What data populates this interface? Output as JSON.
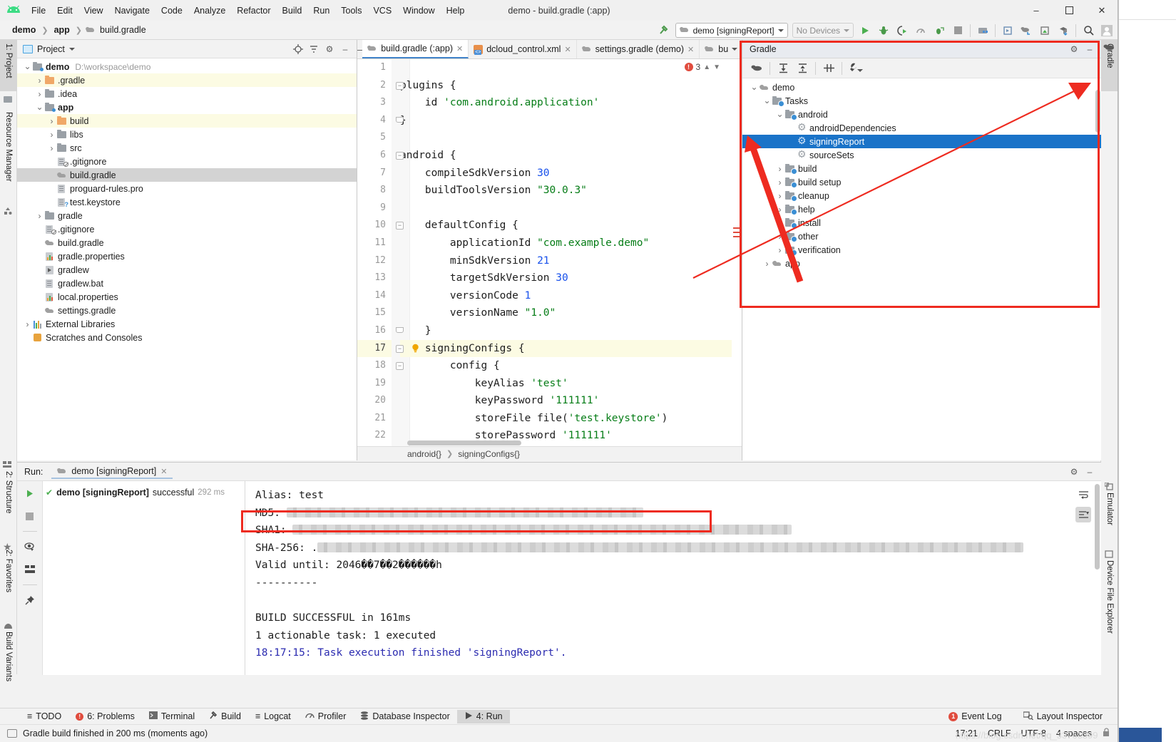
{
  "window": {
    "title": "demo - build.gradle (:app)",
    "minimize": "–",
    "maximize": "☐",
    "close": "✕"
  },
  "menu": [
    "File",
    "Edit",
    "View",
    "Navigate",
    "Code",
    "Analyze",
    "Refactor",
    "Build",
    "Run",
    "Tools",
    "VCS",
    "Window",
    "Help"
  ],
  "breadcrumb": [
    "demo",
    "app",
    "build.gradle"
  ],
  "toolbar": {
    "run_config": "demo [signingReport]",
    "devices": "No Devices",
    "icons": [
      "build-hammer-icon",
      "run-icon",
      "debug-icon",
      "run-coverage-icon",
      "profiler-icon",
      "attach-debugger-icon",
      "stop-icon",
      "sdk-manager-icon",
      "avd-manager-icon",
      "sync-gradle-icon",
      "device-manager-icon",
      "layout-inspector-icon",
      "search-icon",
      "user-icon"
    ]
  },
  "left_strip": [
    {
      "label": "1: Project",
      "selected": true
    },
    {
      "label": "Resource Manager",
      "selected": false
    },
    {
      "label": "2: Structure",
      "selected": false
    },
    {
      "label": "2: Favorites",
      "selected": false
    },
    {
      "label": "Build Variants",
      "selected": false
    }
  ],
  "right_strip": [
    {
      "label": "Gradle",
      "selected": true
    },
    {
      "label": "Emulator",
      "selected": false
    },
    {
      "label": "Device File Explorer",
      "selected": false
    }
  ],
  "project_panel": {
    "title": "Project",
    "header_icons": [
      "locate-icon",
      "collapse-all-icon",
      "settings-gear-icon",
      "hide-icon"
    ],
    "tree": [
      {
        "depth": 0,
        "arrow": "v",
        "icon": "folder-module",
        "label": "demo",
        "bold": true,
        "path": "D:\\workspace\\demo",
        "hl": "none"
      },
      {
        "depth": 1,
        "arrow": ">",
        "icon": "folder-orange",
        "label": ".gradle",
        "bold": false,
        "path": "",
        "hl": "yellow"
      },
      {
        "depth": 1,
        "arrow": ">",
        "icon": "folder",
        "label": ".idea",
        "bold": false,
        "path": "",
        "hl": "none"
      },
      {
        "depth": 1,
        "arrow": "v",
        "icon": "folder-module",
        "label": "app",
        "bold": true,
        "path": "",
        "hl": "none"
      },
      {
        "depth": 2,
        "arrow": ">",
        "icon": "folder-orange",
        "label": "build",
        "bold": false,
        "path": "",
        "hl": "yellow"
      },
      {
        "depth": 2,
        "arrow": ">",
        "icon": "folder",
        "label": "libs",
        "bold": false,
        "path": "",
        "hl": "none"
      },
      {
        "depth": 2,
        "arrow": ">",
        "icon": "folder",
        "label": "src",
        "bold": false,
        "path": "",
        "hl": "none"
      },
      {
        "depth": 2,
        "arrow": "",
        "icon": "file-gitignore",
        "label": ".gitignore",
        "bold": false,
        "path": "",
        "hl": "none"
      },
      {
        "depth": 2,
        "arrow": "",
        "icon": "file-gradle",
        "label": "build.gradle",
        "bold": false,
        "path": "",
        "hl": "grey"
      },
      {
        "depth": 2,
        "arrow": "",
        "icon": "file-text",
        "label": "proguard-rules.pro",
        "bold": false,
        "path": "",
        "hl": "none"
      },
      {
        "depth": 2,
        "arrow": "",
        "icon": "file-keystore",
        "label": "test.keystore",
        "bold": false,
        "path": "",
        "hl": "none"
      },
      {
        "depth": 1,
        "arrow": ">",
        "icon": "folder",
        "label": "gradle",
        "bold": false,
        "path": "",
        "hl": "none"
      },
      {
        "depth": 1,
        "arrow": "",
        "icon": "file-gitignore",
        "label": ".gitignore",
        "bold": false,
        "path": "",
        "hl": "none"
      },
      {
        "depth": 1,
        "arrow": "",
        "icon": "file-gradle",
        "label": "build.gradle",
        "bold": false,
        "path": "",
        "hl": "none"
      },
      {
        "depth": 1,
        "arrow": "",
        "icon": "file-properties",
        "label": "gradle.properties",
        "bold": false,
        "path": "",
        "hl": "none"
      },
      {
        "depth": 1,
        "arrow": "",
        "icon": "file-run",
        "label": "gradlew",
        "bold": false,
        "path": "",
        "hl": "none"
      },
      {
        "depth": 1,
        "arrow": "",
        "icon": "file-text",
        "label": "gradlew.bat",
        "bold": false,
        "path": "",
        "hl": "none"
      },
      {
        "depth": 1,
        "arrow": "",
        "icon": "file-properties",
        "label": "local.properties",
        "bold": false,
        "path": "",
        "hl": "none"
      },
      {
        "depth": 1,
        "arrow": "",
        "icon": "file-gradle",
        "label": "settings.gradle",
        "bold": false,
        "path": "",
        "hl": "none"
      },
      {
        "depth": 0,
        "arrow": ">",
        "icon": "libraries",
        "label": "External Libraries",
        "bold": false,
        "path": "",
        "hl": "none"
      },
      {
        "depth": 0,
        "arrow": "",
        "icon": "console",
        "label": "Scratches and Consoles",
        "bold": false,
        "path": "",
        "hl": "none"
      }
    ]
  },
  "editor": {
    "tabs": [
      {
        "label": "build.gradle (:app)",
        "icon": "gradle-icon",
        "active": true
      },
      {
        "label": "dcloud_control.xml",
        "icon": "xml-icon",
        "active": false
      },
      {
        "label": "settings.gradle (demo)",
        "icon": "gradle-icon",
        "active": false
      },
      {
        "label": "bu",
        "icon": "gradle-icon",
        "active": false
      }
    ],
    "error_count": "3",
    "breadcrumb": [
      "android{}",
      "signingConfigs{}"
    ],
    "lines": [
      {
        "n": "1",
        "text": "",
        "cur": false,
        "fold": ""
      },
      {
        "n": "2",
        "text": "plugins {",
        "cur": false,
        "fold": "-"
      },
      {
        "n": "3",
        "text": "    id 'com.android.application'",
        "cur": false,
        "fold": ""
      },
      {
        "n": "4",
        "text": "}",
        "cur": false,
        "fold": "e"
      },
      {
        "n": "5",
        "text": "",
        "cur": false,
        "fold": ""
      },
      {
        "n": "6",
        "text": "android {",
        "cur": false,
        "fold": "-"
      },
      {
        "n": "7",
        "text": "    compileSdkVersion 30",
        "cur": false,
        "fold": ""
      },
      {
        "n": "8",
        "text": "    buildToolsVersion \"30.0.3\"",
        "cur": false,
        "fold": ""
      },
      {
        "n": "9",
        "text": "",
        "cur": false,
        "fold": ""
      },
      {
        "n": "10",
        "text": "    defaultConfig {",
        "cur": false,
        "fold": "-"
      },
      {
        "n": "11",
        "text": "        applicationId \"com.example.demo\"",
        "cur": false,
        "fold": ""
      },
      {
        "n": "12",
        "text": "        minSdkVersion 21",
        "cur": false,
        "fold": ""
      },
      {
        "n": "13",
        "text": "        targetSdkVersion 30",
        "cur": false,
        "fold": ""
      },
      {
        "n": "14",
        "text": "        versionCode 1",
        "cur": false,
        "fold": ""
      },
      {
        "n": "15",
        "text": "        versionName \"1.0\"",
        "cur": false,
        "fold": ""
      },
      {
        "n": "16",
        "text": "    }",
        "cur": false,
        "fold": "e"
      },
      {
        "n": "17",
        "text": "    signingConfigs {",
        "cur": true,
        "fold": "-"
      },
      {
        "n": "18",
        "text": "        config {",
        "cur": false,
        "fold": "-"
      },
      {
        "n": "19",
        "text": "            keyAlias 'test'",
        "cur": false,
        "fold": ""
      },
      {
        "n": "20",
        "text": "            keyPassword '111111'",
        "cur": false,
        "fold": ""
      },
      {
        "n": "21",
        "text": "            storeFile file('test.keystore')",
        "cur": false,
        "fold": ""
      },
      {
        "n": "22",
        "text": "            storePassword '111111'",
        "cur": false,
        "fold": ""
      }
    ]
  },
  "gradle_panel": {
    "title": "Gradle",
    "toolbar_icons": [
      "execute-gradle-task-icon",
      "expand-all-icon",
      "collapse-all-icon",
      "toggle-offline-icon",
      "wrench-settings-icon"
    ],
    "header_icons": [
      "settings-gear-icon",
      "hide-icon"
    ],
    "tree": [
      {
        "depth": 0,
        "arrow": "v",
        "icon": "gradle-elephant-icon",
        "label": "demo",
        "selected": false
      },
      {
        "depth": 1,
        "arrow": "v",
        "icon": "folder-task-icon",
        "label": "Tasks",
        "selected": false
      },
      {
        "depth": 2,
        "arrow": "v",
        "icon": "folder-task-icon",
        "label": "android",
        "selected": false
      },
      {
        "depth": 3,
        "arrow": "",
        "icon": "gear-task-icon",
        "label": "androidDependencies",
        "selected": false
      },
      {
        "depth": 3,
        "arrow": "",
        "icon": "gear-task-icon",
        "label": "signingReport",
        "selected": true
      },
      {
        "depth": 3,
        "arrow": "",
        "icon": "gear-task-icon",
        "label": "sourceSets",
        "selected": false
      },
      {
        "depth": 2,
        "arrow": ">",
        "icon": "folder-task-icon",
        "label": "build",
        "selected": false
      },
      {
        "depth": 2,
        "arrow": ">",
        "icon": "folder-task-icon",
        "label": "build setup",
        "selected": false
      },
      {
        "depth": 2,
        "arrow": ">",
        "icon": "folder-task-icon",
        "label": "cleanup",
        "selected": false
      },
      {
        "depth": 2,
        "arrow": ">",
        "icon": "folder-task-icon",
        "label": "help",
        "selected": false
      },
      {
        "depth": 2,
        "arrow": ">",
        "icon": "folder-task-icon",
        "label": "install",
        "selected": false
      },
      {
        "depth": 2,
        "arrow": ">",
        "icon": "folder-task-icon",
        "label": "other",
        "selected": false
      },
      {
        "depth": 2,
        "arrow": ">",
        "icon": "folder-task-icon",
        "label": "verification",
        "selected": false
      },
      {
        "depth": 1,
        "arrow": ">",
        "icon": "gradle-elephant-icon",
        "label": "app",
        "selected": false
      }
    ]
  },
  "run_panel": {
    "label": "Run:",
    "tab": "demo [signingReport]",
    "side_icons": [
      "rerun-icon",
      "stop-icon",
      "filter-eye-icon",
      "expand-icon",
      "pin-icon"
    ],
    "header_icons": [
      "settings-gear-icon",
      "hide-icon"
    ],
    "tree_row": {
      "name": "demo [signingReport]",
      "status": "successful",
      "time": "292 ms"
    },
    "console_right_icons": [
      "soft-wrap-icon",
      "scroll-to-end-icon"
    ],
    "console": [
      {
        "text": "Alias: test",
        "blue": false,
        "blur": 0
      },
      {
        "text": "MD5: ",
        "blue": false,
        "blur": 500
      },
      {
        "text": "SHA1: ",
        "blue": false,
        "blur": 700
      },
      {
        "text": "SHA-256: .",
        "blue": false,
        "blur": 990
      },
      {
        "text": "Valid until: 2046��7��2������h",
        "blue": false,
        "blur": 0
      },
      {
        "text": "----------",
        "blue": false,
        "blur": 0
      },
      {
        "text": "",
        "blue": false,
        "blur": 0
      },
      {
        "text": "BUILD SUCCESSFUL in 161ms",
        "blue": false,
        "blur": 0
      },
      {
        "text": "1 actionable task: 1 executed",
        "blue": false,
        "blur": 0
      },
      {
        "text": "18:17:15: Task execution finished 'signingReport'.",
        "blue": true,
        "blur": 0
      }
    ]
  },
  "bottom_bar": {
    "items": [
      {
        "label": "TODO",
        "icon": "todo-icon",
        "active": false
      },
      {
        "label": "6: Problems",
        "icon": "problems-icon",
        "active": false
      },
      {
        "label": "Terminal",
        "icon": "terminal-icon",
        "active": false
      },
      {
        "label": "Build",
        "icon": "build-hammer-icon",
        "active": false
      },
      {
        "label": "Logcat",
        "icon": "logcat-icon",
        "active": false
      },
      {
        "label": "Profiler",
        "icon": "profiler-icon",
        "active": false
      },
      {
        "label": "Database Inspector",
        "icon": "database-icon",
        "active": false
      },
      {
        "label": "4: Run",
        "icon": "run-icon",
        "active": true
      }
    ],
    "right": [
      {
        "label": "Event Log",
        "icon": "event-log-icon",
        "badge": "1"
      },
      {
        "label": "Layout Inspector",
        "icon": "layout-inspector-icon",
        "badge": ""
      }
    ]
  },
  "status_bar": {
    "message": "Gradle build finished in 200 ms (moments ago)",
    "right": [
      "17:21",
      "CRLF",
      "UTF-8",
      "4 spaces"
    ],
    "lock_icon": "lock-icon",
    "watermark": "https://blog.csdn.net/qq_33763399"
  },
  "colors": {
    "accent_blue": "#1a73c8",
    "annotation_red": "#ee2b20",
    "string_green": "#067d17",
    "number_blue": "#1750eb",
    "console_blue": "#2b2bb0",
    "success_green": "#4caf50"
  }
}
